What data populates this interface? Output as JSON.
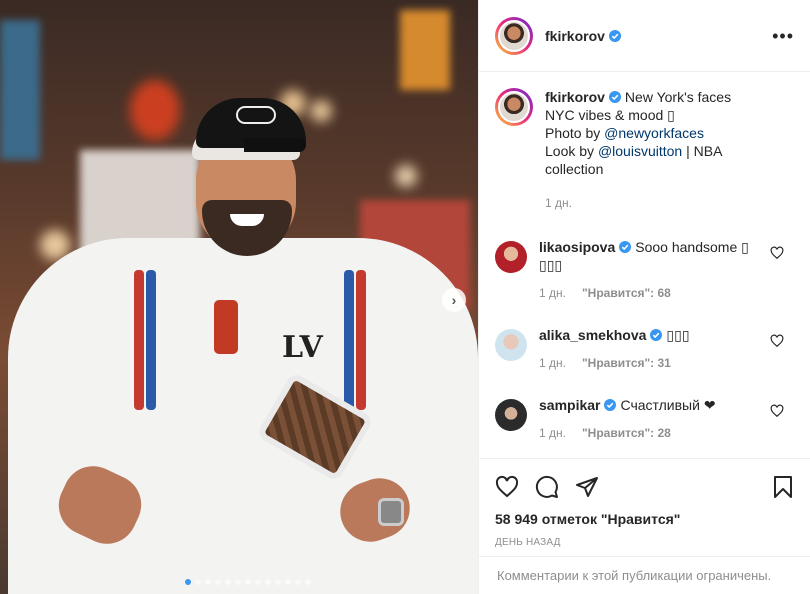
{
  "post": {
    "username": "fkirkorov",
    "more_label": "•••"
  },
  "caption": {
    "username": "fkirkorov",
    "line1": "New York's faces",
    "line2": "NYC vibes & mood",
    "line2_emoji": "▯",
    "photo_by": "Photo by",
    "photo_handle": "@newyorkfaces",
    "look_by": "Look by",
    "look_handle": "@louisvuitton",
    "look_rest": "| NBA",
    "line5": "collection",
    "time": "1 дн."
  },
  "comments": [
    {
      "username": "likaosipova",
      "text": "Sooo handsome ▯",
      "text2": "▯▯▯",
      "time": "1 дн.",
      "likes": "\"Нравится\": 68"
    },
    {
      "username": "alika_smekhova",
      "text": "▯▯▯",
      "time": "1 дн.",
      "likes": "\"Нравится\": 31"
    },
    {
      "username": "sampikar",
      "text": "Счастливый ❤",
      "time": "1 дн.",
      "likes": "\"Нравится\": 28"
    }
  ],
  "engagement": {
    "likes_text": "58 949 отметок \"Нравится\"",
    "posted": "День назад"
  },
  "footer": {
    "comments_disabled": "Комментарии к этой публикации ограничены."
  },
  "carousel": {
    "total_slides": 13,
    "active_index": 0,
    "next_label": "›"
  },
  "colors": {
    "verified": "#3897f0",
    "link": "#00376b",
    "muted": "#8e8e8e"
  },
  "icons": [
    "verified-icon",
    "heart-icon",
    "comment-icon",
    "share-icon",
    "bookmark-icon",
    "more-icon",
    "next-arrow-icon"
  ]
}
